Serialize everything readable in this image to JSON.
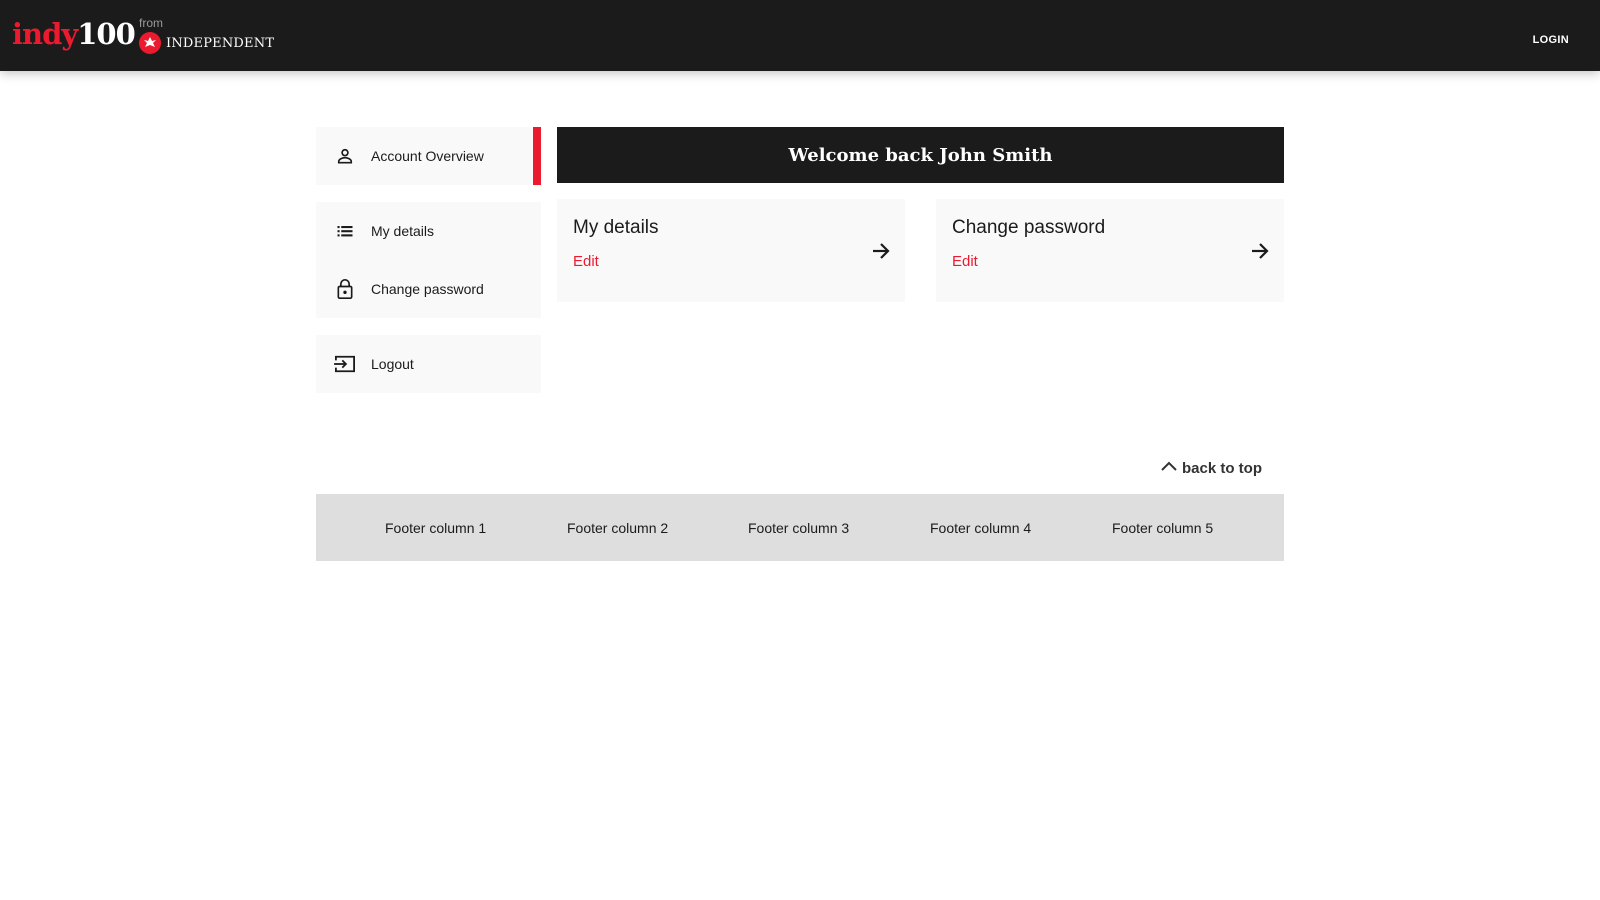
{
  "header": {
    "logo_indy": "indy",
    "logo_100": "100",
    "logo_from": "from",
    "logo_independent": "INDEPENDENT",
    "login_label": "LOGIN"
  },
  "sidebar": {
    "items": [
      {
        "label": "Account Overview",
        "icon": "person-icon",
        "active": true
      },
      {
        "label": "My details",
        "icon": "list-icon"
      },
      {
        "label": "Change password",
        "icon": "lock-icon"
      },
      {
        "label": "Logout",
        "icon": "logout-icon"
      }
    ]
  },
  "main": {
    "welcome": "Welcome back John Smith",
    "cards": [
      {
        "title": "My details",
        "edit_label": "Edit",
        "icon": "arrow-right-icon"
      },
      {
        "title": "Change password",
        "edit_label": "Edit",
        "icon": "arrow-right-icon"
      }
    ]
  },
  "back_to_top": {
    "label": "back to top",
    "icon": "chevron-up-icon"
  },
  "footer": {
    "columns": [
      "Footer column 1",
      "Footer column 2",
      "Footer column 3",
      "Footer column 4",
      "Footer column 5"
    ]
  },
  "colors": {
    "brand_red": "#ec1a2e",
    "header_bg": "#1b1b1b",
    "panel_bg": "#f9f9f9",
    "footer_bg": "#dedede"
  }
}
